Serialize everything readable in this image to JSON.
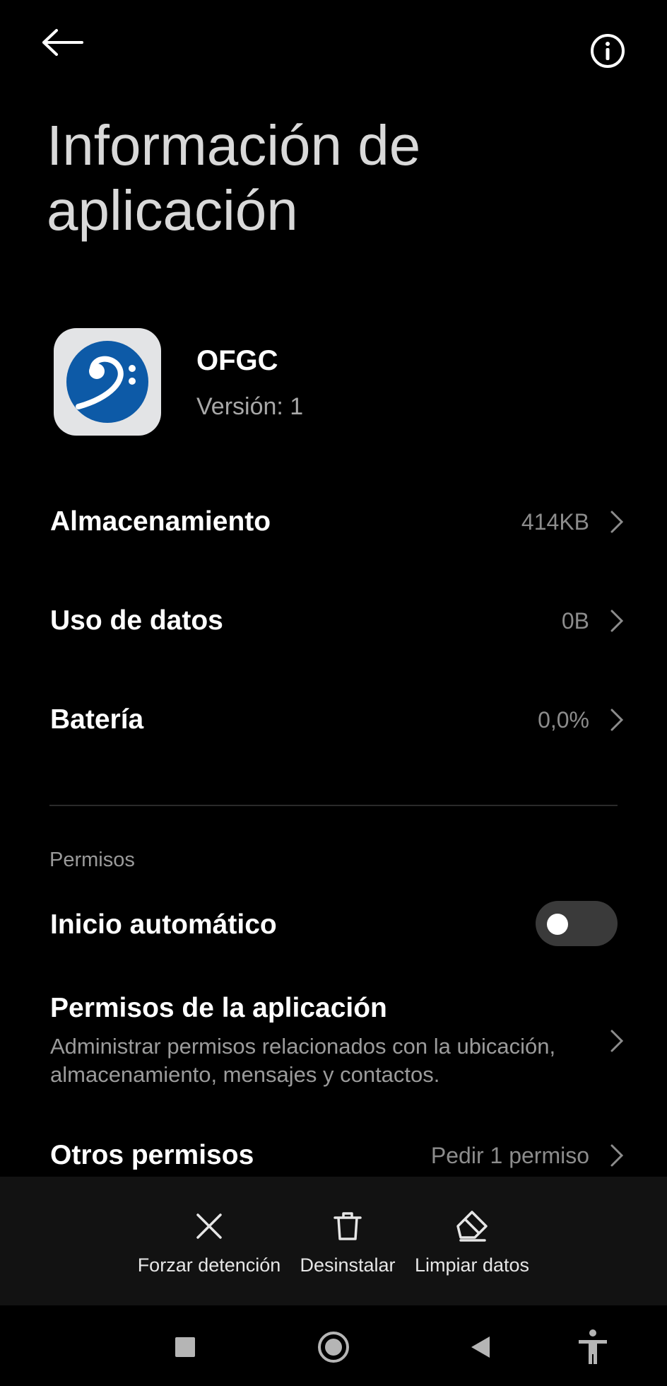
{
  "header": {
    "title_line1": "Información de",
    "title_line2": "aplicación",
    "back_icon": "arrow-left-icon",
    "info_icon": "info-circle-icon"
  },
  "app": {
    "name": "OFGC",
    "version": "Versión: 1",
    "icon": "bass-clef-icon",
    "icon_color": "#0d5aa7"
  },
  "rows": {
    "storage": {
      "label": "Almacenamiento",
      "value": "414KB"
    },
    "data_usage": {
      "label": "Uso de datos",
      "value": "0B"
    },
    "battery": {
      "label": "Batería",
      "value": "0,0%"
    }
  },
  "permissions": {
    "section_label": "Permisos",
    "autostart": {
      "label": "Inicio automático",
      "enabled": false
    },
    "app_permissions": {
      "label": "Permisos de la aplicación",
      "description": "Administrar permisos relacionados con la ubicación, almacenamiento, mensajes y contactos."
    },
    "other": {
      "label": "Otros permisos",
      "value": "Pedir 1 permiso"
    }
  },
  "actions": [
    {
      "label": "Forzar detención",
      "icon": "close-x-icon"
    },
    {
      "label": "Desinstalar",
      "icon": "trash-icon"
    },
    {
      "label": "Limpiar datos",
      "icon": "eraser-icon"
    }
  ],
  "navbar": {
    "recents_icon": "square-icon",
    "home_icon": "circle-icon",
    "back_icon": "triangle-back-icon",
    "accessibility_icon": "accessibility-icon"
  }
}
